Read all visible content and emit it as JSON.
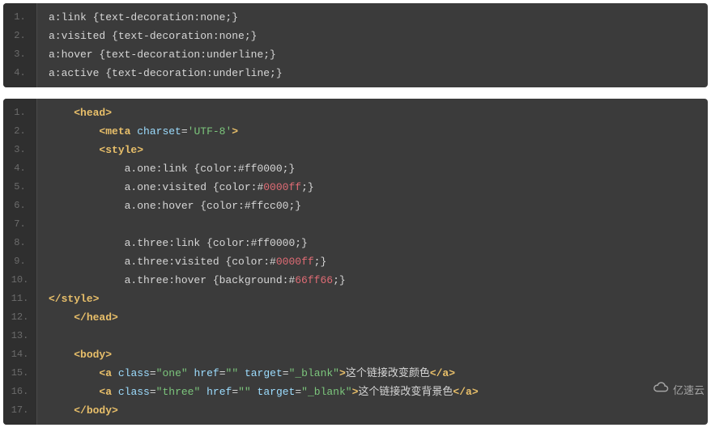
{
  "block1": {
    "lines": [
      [
        {
          "t": "a:link {text-decoration:none;}",
          "c": "c-plain"
        }
      ],
      [
        {
          "t": "a:visited {text-decoration:none;}",
          "c": "c-plain"
        }
      ],
      [
        {
          "t": "a:hover {text-decoration:underline;}",
          "c": "c-plain"
        }
      ],
      [
        {
          "t": "a:active {text-decoration:underline;}",
          "c": "c-plain"
        }
      ]
    ]
  },
  "block2": {
    "lines": [
      [
        {
          "t": "    ",
          "c": "c-plain"
        },
        {
          "t": "<head>",
          "c": "c-tag"
        }
      ],
      [
        {
          "t": "        ",
          "c": "c-plain"
        },
        {
          "t": "<meta",
          "c": "c-tag"
        },
        {
          "t": " ",
          "c": "c-plain"
        },
        {
          "t": "charset",
          "c": "c-attr"
        },
        {
          "t": "=",
          "c": "c-plain"
        },
        {
          "t": "'UTF-8'",
          "c": "c-valgreen"
        },
        {
          "t": ">",
          "c": "c-tag"
        }
      ],
      [
        {
          "t": "        ",
          "c": "c-plain"
        },
        {
          "t": "<style>",
          "c": "c-tag"
        }
      ],
      [
        {
          "t": "            a.one:link {color:#ff0000;}",
          "c": "c-plain"
        }
      ],
      [
        {
          "t": "            a.one:visited {color:#",
          "c": "c-plain"
        },
        {
          "t": "0000ff",
          "c": "c-red"
        },
        {
          "t": ";}",
          "c": "c-plain"
        }
      ],
      [
        {
          "t": "            a.one:hover {color:#ffcc00;}",
          "c": "c-plain"
        }
      ],
      [
        {
          "t": " ",
          "c": "c-plain"
        }
      ],
      [
        {
          "t": "            a.three:link {color:#ff0000;}",
          "c": "c-plain"
        }
      ],
      [
        {
          "t": "            a.three:visited {color:#",
          "c": "c-plain"
        },
        {
          "t": "0000ff",
          "c": "c-red"
        },
        {
          "t": ";}",
          "c": "c-plain"
        }
      ],
      [
        {
          "t": "            a.three:hover {background:#",
          "c": "c-plain"
        },
        {
          "t": "66ff66",
          "c": "c-red"
        },
        {
          "t": ";}",
          "c": "c-plain"
        }
      ],
      [
        {
          "t": "",
          "c": "c-plain"
        },
        {
          "t": "</style>",
          "c": "c-tag"
        }
      ],
      [
        {
          "t": "    ",
          "c": "c-plain"
        },
        {
          "t": "</head>",
          "c": "c-tag"
        }
      ],
      [
        {
          "t": " ",
          "c": "c-plain"
        }
      ],
      [
        {
          "t": "    ",
          "c": "c-plain"
        },
        {
          "t": "<body>",
          "c": "c-tag"
        }
      ],
      [
        {
          "t": "        ",
          "c": "c-plain"
        },
        {
          "t": "<a",
          "c": "c-tag"
        },
        {
          "t": " ",
          "c": "c-plain"
        },
        {
          "t": "class",
          "c": "c-attr"
        },
        {
          "t": "=",
          "c": "c-plain"
        },
        {
          "t": "\"one\"",
          "c": "c-valgreen"
        },
        {
          "t": " ",
          "c": "c-plain"
        },
        {
          "t": "href",
          "c": "c-attr"
        },
        {
          "t": "=",
          "c": "c-plain"
        },
        {
          "t": "\"\"",
          "c": "c-valgreen"
        },
        {
          "t": " ",
          "c": "c-plain"
        },
        {
          "t": "target",
          "c": "c-attr"
        },
        {
          "t": "=",
          "c": "c-plain"
        },
        {
          "t": "\"_blank\"",
          "c": "c-valgreen"
        },
        {
          "t": ">",
          "c": "c-tag"
        },
        {
          "t": "这个链接改变颜色",
          "c": "c-plain"
        },
        {
          "t": "</a>",
          "c": "c-tag"
        }
      ],
      [
        {
          "t": "        ",
          "c": "c-plain"
        },
        {
          "t": "<a",
          "c": "c-tag"
        },
        {
          "t": " ",
          "c": "c-plain"
        },
        {
          "t": "class",
          "c": "c-attr"
        },
        {
          "t": "=",
          "c": "c-plain"
        },
        {
          "t": "\"three\"",
          "c": "c-valgreen"
        },
        {
          "t": " ",
          "c": "c-plain"
        },
        {
          "t": "href",
          "c": "c-attr"
        },
        {
          "t": "=",
          "c": "c-plain"
        },
        {
          "t": "\"\"",
          "c": "c-valgreen"
        },
        {
          "t": " ",
          "c": "c-plain"
        },
        {
          "t": "target",
          "c": "c-attr"
        },
        {
          "t": "=",
          "c": "c-plain"
        },
        {
          "t": "\"_blank\"",
          "c": "c-valgreen"
        },
        {
          "t": ">",
          "c": "c-tag"
        },
        {
          "t": "这个链接改变背景色",
          "c": "c-plain"
        },
        {
          "t": "</a>",
          "c": "c-tag"
        }
      ],
      [
        {
          "t": "    ",
          "c": "c-plain"
        },
        {
          "t": "</body>",
          "c": "c-tag"
        }
      ]
    ]
  },
  "watermark": "亿速云"
}
